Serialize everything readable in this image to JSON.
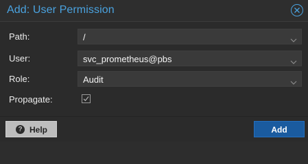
{
  "dialog": {
    "title": "Add: User Permission",
    "close_icon": "close-circle-icon",
    "accent_color": "#4aa3e0"
  },
  "form": {
    "path": {
      "label": "Path:",
      "value": "/"
    },
    "user": {
      "label": "User:",
      "value": "svc_prometheus@pbs"
    },
    "role": {
      "label": "Role:",
      "value": "Audit"
    },
    "propagate": {
      "label": "Propagate:",
      "checked": true
    }
  },
  "footer": {
    "help_label": "Help",
    "help_icon": "question-circle-icon",
    "add_label": "Add",
    "add_color": "#1a5b9f"
  }
}
